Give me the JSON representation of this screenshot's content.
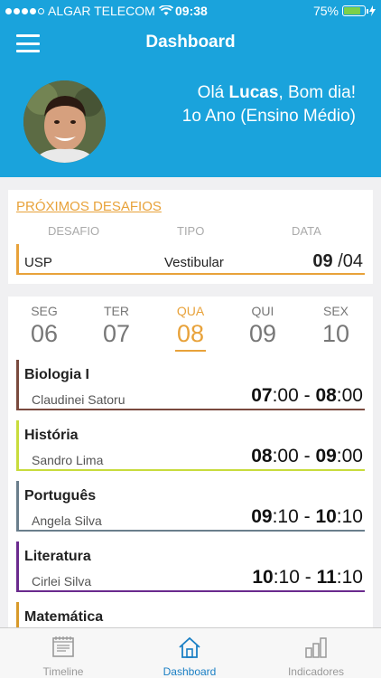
{
  "status_bar": {
    "carrier": "ALGAR TELECOM",
    "time": "09:38",
    "battery": "75%",
    "battery_level": 0.75
  },
  "header": {
    "title": "Dashboard"
  },
  "profile": {
    "greeting_prefix": "Olá ",
    "name": "Lucas",
    "greeting_suffix": ", Bom dia!",
    "class_info": "1o Ano (Ensino Médio)"
  },
  "challenges": {
    "title": "PRÓXIMOS DESAFIOS",
    "columns": {
      "challenge": "DESAFIO",
      "type": "TIPO",
      "date": "DATA"
    },
    "items": [
      {
        "name": "USP",
        "type": "Vestibular",
        "day": "09",
        "month": " /04"
      }
    ]
  },
  "schedule": {
    "days": [
      {
        "name": "SEG",
        "num": "06"
      },
      {
        "name": "TER",
        "num": "07"
      },
      {
        "name": "QUA",
        "num": "08",
        "active": true
      },
      {
        "name": "QUI",
        "num": "09"
      },
      {
        "name": "SEX",
        "num": "10"
      }
    ],
    "classes": [
      {
        "subject": "Biologia I",
        "teacher": "Claudinei Satoru",
        "start_h": "07",
        "start_m": ":00",
        "sep": " - ",
        "end_h": "08",
        "end_m": ":00",
        "color": "#7a4a3e"
      },
      {
        "subject": "História",
        "teacher": "Sandro Lima",
        "start_h": "08",
        "start_m": ":00",
        "sep": " - ",
        "end_h": "09",
        "end_m": ":00",
        "color": "#c8dc3c"
      },
      {
        "subject": "Português",
        "teacher": "Angela Silva",
        "start_h": "09",
        "start_m": ":10",
        "sep": " - ",
        "end_h": "10",
        "end_m": ":10",
        "color": "#6a7e8c"
      },
      {
        "subject": "Literatura",
        "teacher": "Cirlei Silva",
        "start_h": "10",
        "start_m": ":10",
        "sep": " - ",
        "end_h": "11",
        "end_m": ":10",
        "color": "#6a2a8e"
      },
      {
        "subject": "Matemática",
        "teacher": "",
        "start_h": "",
        "start_m": "",
        "sep": "",
        "end_h": "",
        "end_m": "",
        "color": "#d89a2a"
      }
    ]
  },
  "tabs": [
    {
      "label": "Timeline",
      "icon": "timeline-icon"
    },
    {
      "label": "Dashboard",
      "icon": "home-icon",
      "active": true
    },
    {
      "label": "Indicadores",
      "icon": "bar-chart-icon"
    }
  ],
  "colors": {
    "primary": "#1aa3dc",
    "accent": "#e8a23a",
    "tab_active": "#1a7fc4"
  }
}
